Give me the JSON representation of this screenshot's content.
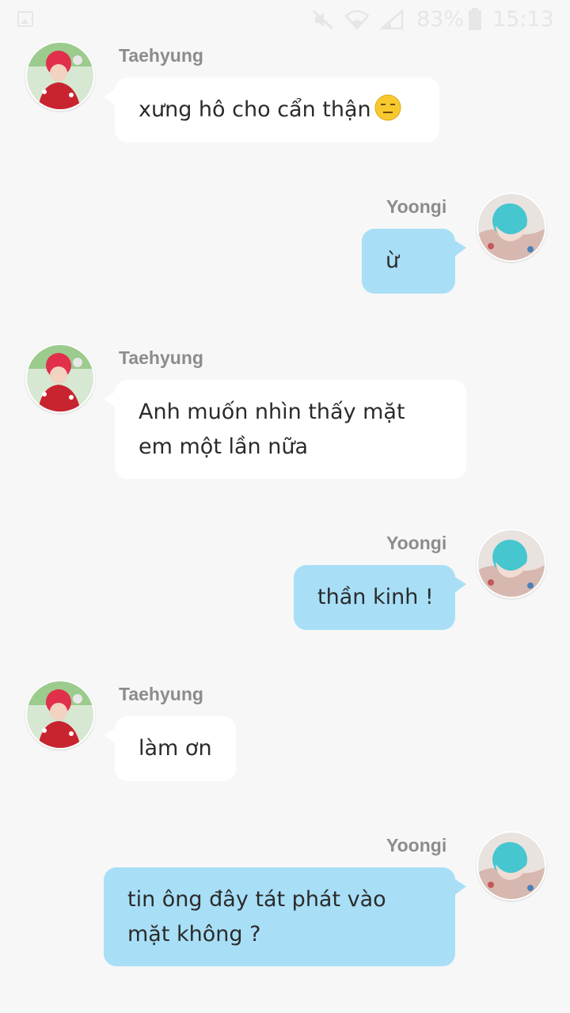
{
  "status_bar": {
    "battery_percent": "83%",
    "time": "15:13",
    "icons": [
      "gallery-icon",
      "mute-icon",
      "wifi-icon",
      "signal-icon",
      "battery-icon"
    ]
  },
  "colors": {
    "background": "#f7f7f7",
    "left_bubble": "#ffffff",
    "right_bubble": "#a8dff7",
    "name_text": "#8c8c8c",
    "message_text": "#2b2b2b"
  },
  "messages": [
    {
      "sender": "Taehyung",
      "side": "left",
      "lines": [
        "xưng hô cho cẩn thận"
      ],
      "emoji": "expressionless-face-emoji"
    },
    {
      "sender": "Yoongi",
      "side": "right",
      "lines": [
        "ừ"
      ]
    },
    {
      "sender": "Taehyung",
      "side": "left",
      "lines": [
        "Anh muốn nhìn thấy mặt",
        "em một lần nữa"
      ]
    },
    {
      "sender": "Yoongi",
      "side": "right",
      "lines": [
        "thần kinh !"
      ]
    },
    {
      "sender": "Taehyung",
      "side": "left",
      "lines": [
        "làm ơn"
      ]
    },
    {
      "sender": "Yoongi",
      "side": "right",
      "lines": [
        "tin ông đây tát phát vào",
        "mặt không ?"
      ]
    }
  ]
}
